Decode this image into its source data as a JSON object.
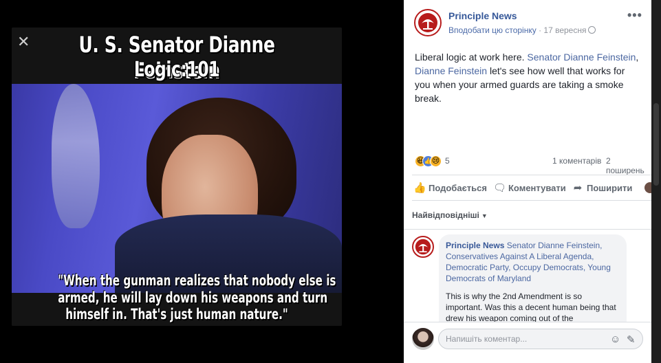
{
  "meme": {
    "title_line1": "U. S. Senator Dianne Feinstein",
    "title_line2": "Logic:101",
    "caption_line1": "\"When the gunman realizes that nobody else is",
    "caption_line2": "armed, he will lay down his weapons and turn",
    "caption_line3": "himself in. That's just human nature.\""
  },
  "post": {
    "page_name": "Principle News",
    "like_page": "Вподобати цю сторінку",
    "separator": " · ",
    "date": "17 вересня",
    "more": "•••",
    "text_before": "Liberal logic at work here. ",
    "tag1": "Senator Dianne Feinstein",
    "text_mid": ", ",
    "tag2": "Dianne Feinstein",
    "text_after": " let's see how well that works for you when your armed guards are taking a smoke break.",
    "reaction_count": "5",
    "comments_count": "1 коментарів",
    "shares_count": "2 поширень"
  },
  "actions": {
    "like": "Подобається",
    "comment": "Коментувати",
    "share": "Поширити"
  },
  "icons": {
    "like": "thumbs-up-icon",
    "comment": "comment-icon",
    "share": "share-icon",
    "emoji": "emoji-icon",
    "sticker": "sticker-icon"
  },
  "comments": {
    "sort_label": "Найвідповідніші",
    "items": [
      {
        "author": "Principle News",
        "tags": "Senator Dianne Feinstein, Conservatives Against A Liberal Agenda, Democratic Party, Occupy Democrats, Young Democrats of Maryland",
        "body": "This is why the 2nd Amendment is so important. Was this a decent human being that drew his weapon coming out of the"
      }
    ]
  },
  "composer": {
    "placeholder": "Напишіть коментар..."
  },
  "colors": {
    "link": "#365899",
    "brand_red": "#b71c1c",
    "panel_bg": "#ffffff",
    "viewer_bg": "#000000"
  }
}
